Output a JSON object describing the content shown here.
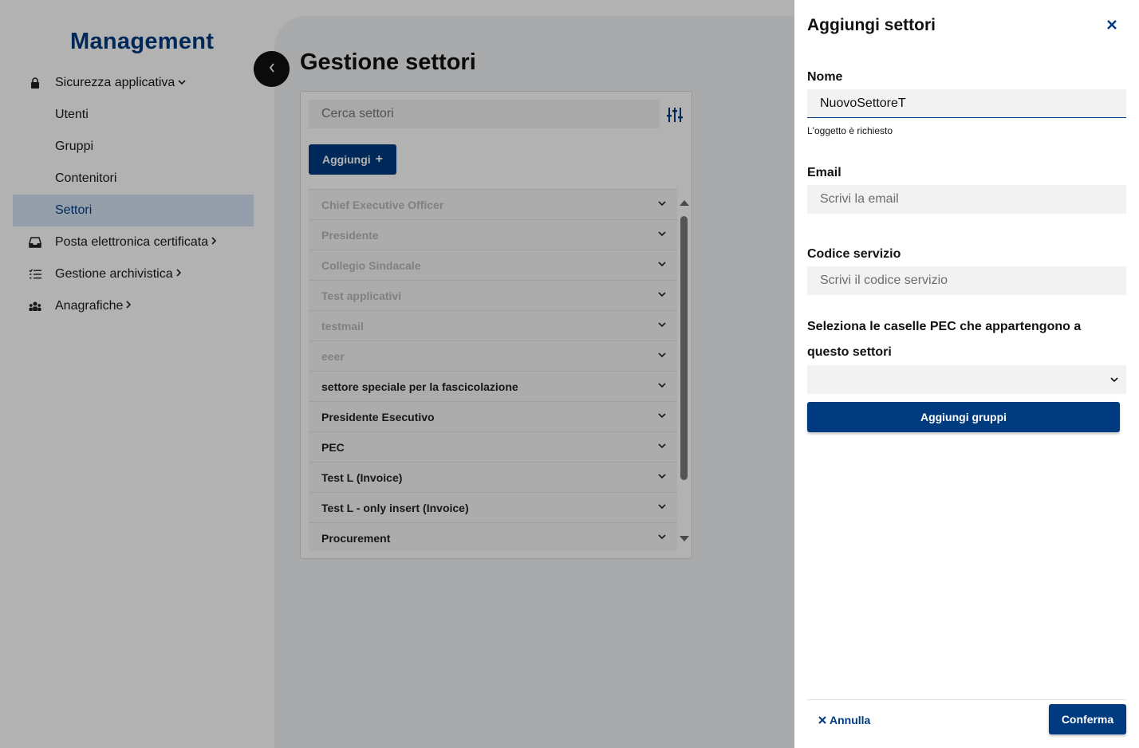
{
  "sidebar": {
    "app_title": "Management",
    "items": [
      {
        "label": "Sicurezza applicativa",
        "icon": "lock-icon",
        "chevron": "chevron-down-icon",
        "active": false
      },
      {
        "label": "Utenti",
        "icon": "",
        "chevron": "",
        "active": false
      },
      {
        "label": "Gruppi",
        "icon": "",
        "chevron": "",
        "active": false
      },
      {
        "label": "Contenitori",
        "icon": "",
        "chevron": "",
        "active": false
      },
      {
        "label": "Settori",
        "icon": "",
        "chevron": "",
        "active": true
      },
      {
        "label": "Posta elettronica certificata",
        "icon": "inbox-icon",
        "chevron": "chevron-right-icon",
        "active": false
      },
      {
        "label": "Gestione archivistica",
        "icon": "list-icon",
        "chevron": "chevron-right-icon",
        "active": false
      },
      {
        "label": "Anagrafiche",
        "icon": "people-icon",
        "chevron": "chevron-right-icon",
        "active": false
      }
    ],
    "collapse_icon": "chevron-left-icon"
  },
  "main": {
    "page_title": "Gestione settori",
    "search": {
      "placeholder": "Cerca settori",
      "filter_icon": "sliders-icon"
    },
    "add_button": {
      "label": "Aggiungi",
      "icon": "plus-icon"
    },
    "sectors": [
      {
        "label": "Chief Executive Officer",
        "disabled": true
      },
      {
        "label": "Presidente",
        "disabled": true
      },
      {
        "label": "Collegio Sindacale",
        "disabled": true
      },
      {
        "label": "Test applicativi",
        "disabled": true
      },
      {
        "label": "testmail",
        "disabled": true
      },
      {
        "label": "eeer",
        "disabled": true
      },
      {
        "label": "settore speciale per la fascicolazione",
        "disabled": false
      },
      {
        "label": "Presidente Esecutivo",
        "disabled": false
      },
      {
        "label": "PEC",
        "disabled": false
      },
      {
        "label": "Test L (Invoice)",
        "disabled": false
      },
      {
        "label": "Test L - only insert (Invoice)",
        "disabled": false
      },
      {
        "label": "Procurement",
        "disabled": false
      }
    ]
  },
  "drawer": {
    "title": "Aggiungi settori",
    "close_icon": "close-icon",
    "nome": {
      "label": "Nome",
      "value": "NuovoSettoreT",
      "error": "L'oggetto è richiesto"
    },
    "email": {
      "label": "Email",
      "placeholder": "Scrivi la email"
    },
    "codice": {
      "label": "Codice servizio",
      "placeholder": "Scrivi il codice servizio"
    },
    "pec": {
      "label": "Seleziona le caselle PEC che appartengono a questo settori",
      "selected": ""
    },
    "add_groups_label": "Aggiungi gruppi",
    "cancel_label": "Annulla",
    "confirm_label": "Conferma"
  },
  "colors": {
    "brand": "#003b80",
    "active_bg": "#d6e4f7",
    "overlay": "rgba(0,0,0,0.30)"
  }
}
